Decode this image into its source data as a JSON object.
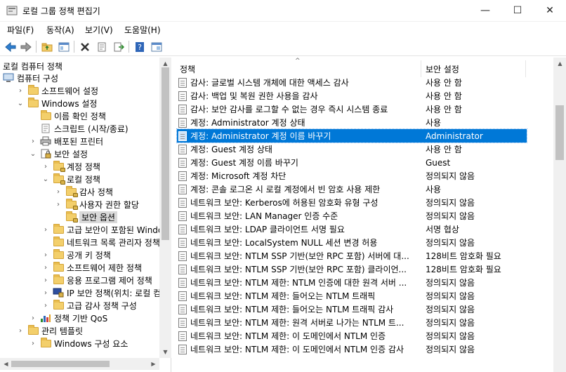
{
  "window": {
    "title": "로컬 그룹 정책 편집기",
    "minimize_glyph": "—",
    "maximize_glyph": "☐",
    "close_glyph": "✕"
  },
  "menu": [
    "파일(F)",
    "동작(A)",
    "보기(V)",
    "도움말(H)"
  ],
  "toolbar": {
    "icons": [
      "back-arrow-icon",
      "forward-arrow-icon",
      "up-folder-icon",
      "show-hide-tree-icon",
      "delete-icon",
      "properties-icon",
      "export-list-icon",
      "help-icon",
      "view-icon"
    ]
  },
  "tree": {
    "header": "로컬 컴퓨터 정책",
    "items": [
      {
        "label": "컴퓨터 구성",
        "depth": 0,
        "twisty": "",
        "icon": "computer"
      },
      {
        "label": "소프트웨어 설정",
        "depth": 1,
        "twisty": "›",
        "icon": "folder"
      },
      {
        "label": "Windows 설정",
        "depth": 1,
        "twisty": "⌄",
        "icon": "folder"
      },
      {
        "label": "이름 확인 정책",
        "depth": 2,
        "twisty": "",
        "icon": "folder"
      },
      {
        "label": "스크립트 (시작/종료)",
        "depth": 2,
        "twisty": "",
        "icon": "script"
      },
      {
        "label": "배포된 프린터",
        "depth": 2,
        "twisty": "›",
        "icon": "printer"
      },
      {
        "label": "보안 설정",
        "depth": 2,
        "twisty": "⌄",
        "icon": "security"
      },
      {
        "label": "계정 정책",
        "depth": 3,
        "twisty": "›",
        "icon": "lock-folder"
      },
      {
        "label": "로컬 정책",
        "depth": 3,
        "twisty": "⌄",
        "icon": "lock-folder"
      },
      {
        "label": "감사 정책",
        "depth": 4,
        "twisty": "›",
        "icon": "lock-folder"
      },
      {
        "label": "사용자 권한 할당",
        "depth": 4,
        "twisty": "›",
        "icon": "lock-folder"
      },
      {
        "label": "보안 옵션",
        "depth": 4,
        "twisty": "",
        "icon": "lock-folder",
        "selected": true
      },
      {
        "label": "고급 보안이 포함된 Window",
        "depth": 3,
        "twisty": "›",
        "icon": "folder"
      },
      {
        "label": "네트워크 목록 관리자 정책",
        "depth": 3,
        "twisty": "",
        "icon": "folder"
      },
      {
        "label": "공개 키 정책",
        "depth": 3,
        "twisty": "›",
        "icon": "folder"
      },
      {
        "label": "소프트웨어 제한 정책",
        "depth": 3,
        "twisty": "›",
        "icon": "folder"
      },
      {
        "label": "응용 프로그램 제어 정책",
        "depth": 3,
        "twisty": "›",
        "icon": "folder"
      },
      {
        "label": "IP 보안 정책(위치: 로컬 컴",
        "depth": 3,
        "twisty": "›",
        "icon": "ipsec"
      },
      {
        "label": "고급 감사 정책 구성",
        "depth": 3,
        "twisty": "›",
        "icon": "folder"
      },
      {
        "label": "정책 기반 QoS",
        "depth": 2,
        "twisty": "›",
        "icon": "chart"
      },
      {
        "label": "관리 템플릿",
        "depth": 1,
        "twisty": "›",
        "icon": "folder"
      },
      {
        "label": "Windows 구성 요소",
        "depth": 2,
        "twisty": "›",
        "icon": "folder"
      }
    ]
  },
  "list": {
    "columns": [
      "정책",
      "보안 설정"
    ],
    "rows": [
      {
        "policy": "감사: 글로벌 시스템 개체에 대한 액세스 감사",
        "setting": "사용 안 함"
      },
      {
        "policy": "감사: 백업 및 복원 권한 사용을 감사",
        "setting": "사용 안 함"
      },
      {
        "policy": "감사: 보안 감사를 로그할 수 없는 경우 즉시 시스템 종료",
        "setting": "사용 안 함"
      },
      {
        "policy": "계정: Administrator 계정 상태",
        "setting": "사용"
      },
      {
        "policy": "계정: Administrator 계정 이름 바꾸기",
        "setting": "Administrator",
        "selected": true
      },
      {
        "policy": "계정: Guest 계정 상태",
        "setting": "사용 안 함"
      },
      {
        "policy": "계정: Guest 계정 이름 바꾸기",
        "setting": "Guest"
      },
      {
        "policy": "계정: Microsoft 계정 차단",
        "setting": "정의되지 않음"
      },
      {
        "policy": "계정: 콘솔 로그온 시 로컬 계정에서 빈 암호 사용 제한",
        "setting": "사용"
      },
      {
        "policy": "네트워크 보안: Kerberos에 허용된 암호화 유형 구성",
        "setting": "정의되지 않음"
      },
      {
        "policy": "네트워크 보안: LAN Manager 인증 수준",
        "setting": "정의되지 않음"
      },
      {
        "policy": "네트워크 보안: LDAP 클라이언트 서명 필요",
        "setting": "서명 협상"
      },
      {
        "policy": "네트워크 보안: LocalSystem NULL 세션 변경 허용",
        "setting": "정의되지 않음"
      },
      {
        "policy": "네트워크 보안: NTLM SSP 기반(보안 RPC 포함) 서버에 대...",
        "setting": "128비트 암호화 필요"
      },
      {
        "policy": "네트워크 보안: NTLM SSP 기반(보안 RPC 포함) 클라이언...",
        "setting": "128비트 암호화 필요"
      },
      {
        "policy": "네트워크 보안: NTLM 제한: NTLM 인증에 대한 원격 서버 ...",
        "setting": "정의되지 않음"
      },
      {
        "policy": "네트워크 보안: NTLM 제한: 들어오는 NTLM 트래픽",
        "setting": "정의되지 않음"
      },
      {
        "policy": "네트워크 보안: NTLM 제한: 들어오는 NTLM 트래픽 감사",
        "setting": "정의되지 않음"
      },
      {
        "policy": "네트워크 보안: NTLM 제한: 원격 서버로 나가는 NTLM 트...",
        "setting": "정의되지 않음"
      },
      {
        "policy": "네트워크 보안: NTLM 제한: 이 도메인에서 NTLM 인증",
        "setting": "정의되지 않음"
      },
      {
        "policy": "네트워크 보안: NTLM 제한: 이 도메인에서 NTLM 인증 감사",
        "setting": "정의되지 않음"
      }
    ]
  }
}
